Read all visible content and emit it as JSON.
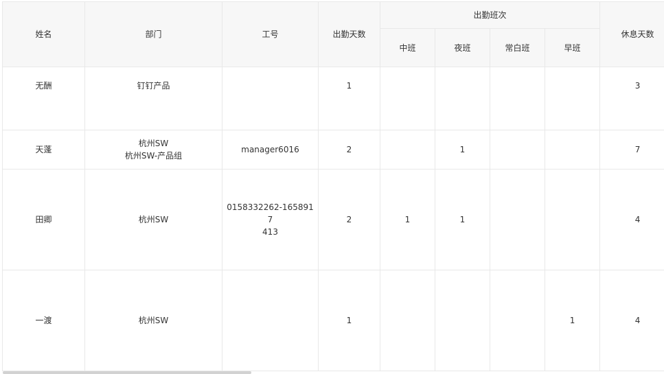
{
  "table": {
    "headers": {
      "name": "姓名",
      "dept": "部门",
      "employee_id": "工号",
      "attendance_days": "出勤天数",
      "shift_group": "出勤班次",
      "shift_middle": "中班",
      "shift_night": "夜班",
      "shift_day": "常白班",
      "shift_morning": "早班",
      "rest_days": "休息天数"
    },
    "rows": [
      {
        "name": "无酬",
        "dept": [
          "钉钉产品"
        ],
        "employee_id": [],
        "attendance_days": "1",
        "middle": "",
        "night": "",
        "day": "",
        "morning": "",
        "rest_days": "3"
      },
      {
        "name": "天蓬",
        "dept": [
          "杭州SW",
          "杭州SW-产品组"
        ],
        "employee_id": [
          "manager6016"
        ],
        "attendance_days": "2",
        "middle": "",
        "night": "1",
        "day": "",
        "morning": "",
        "rest_days": "7"
      },
      {
        "name": "田卿",
        "dept": [
          "杭州SW"
        ],
        "employee_id": [
          "0158332262-1658917",
          "413"
        ],
        "attendance_days": "2",
        "middle": "1",
        "night": "1",
        "day": "",
        "morning": "",
        "rest_days": "4"
      },
      {
        "name": "一渡",
        "dept": [
          "杭州SW"
        ],
        "employee_id": [],
        "attendance_days": "1",
        "middle": "",
        "night": "",
        "day": "",
        "morning": "1",
        "rest_days": "4"
      }
    ]
  }
}
